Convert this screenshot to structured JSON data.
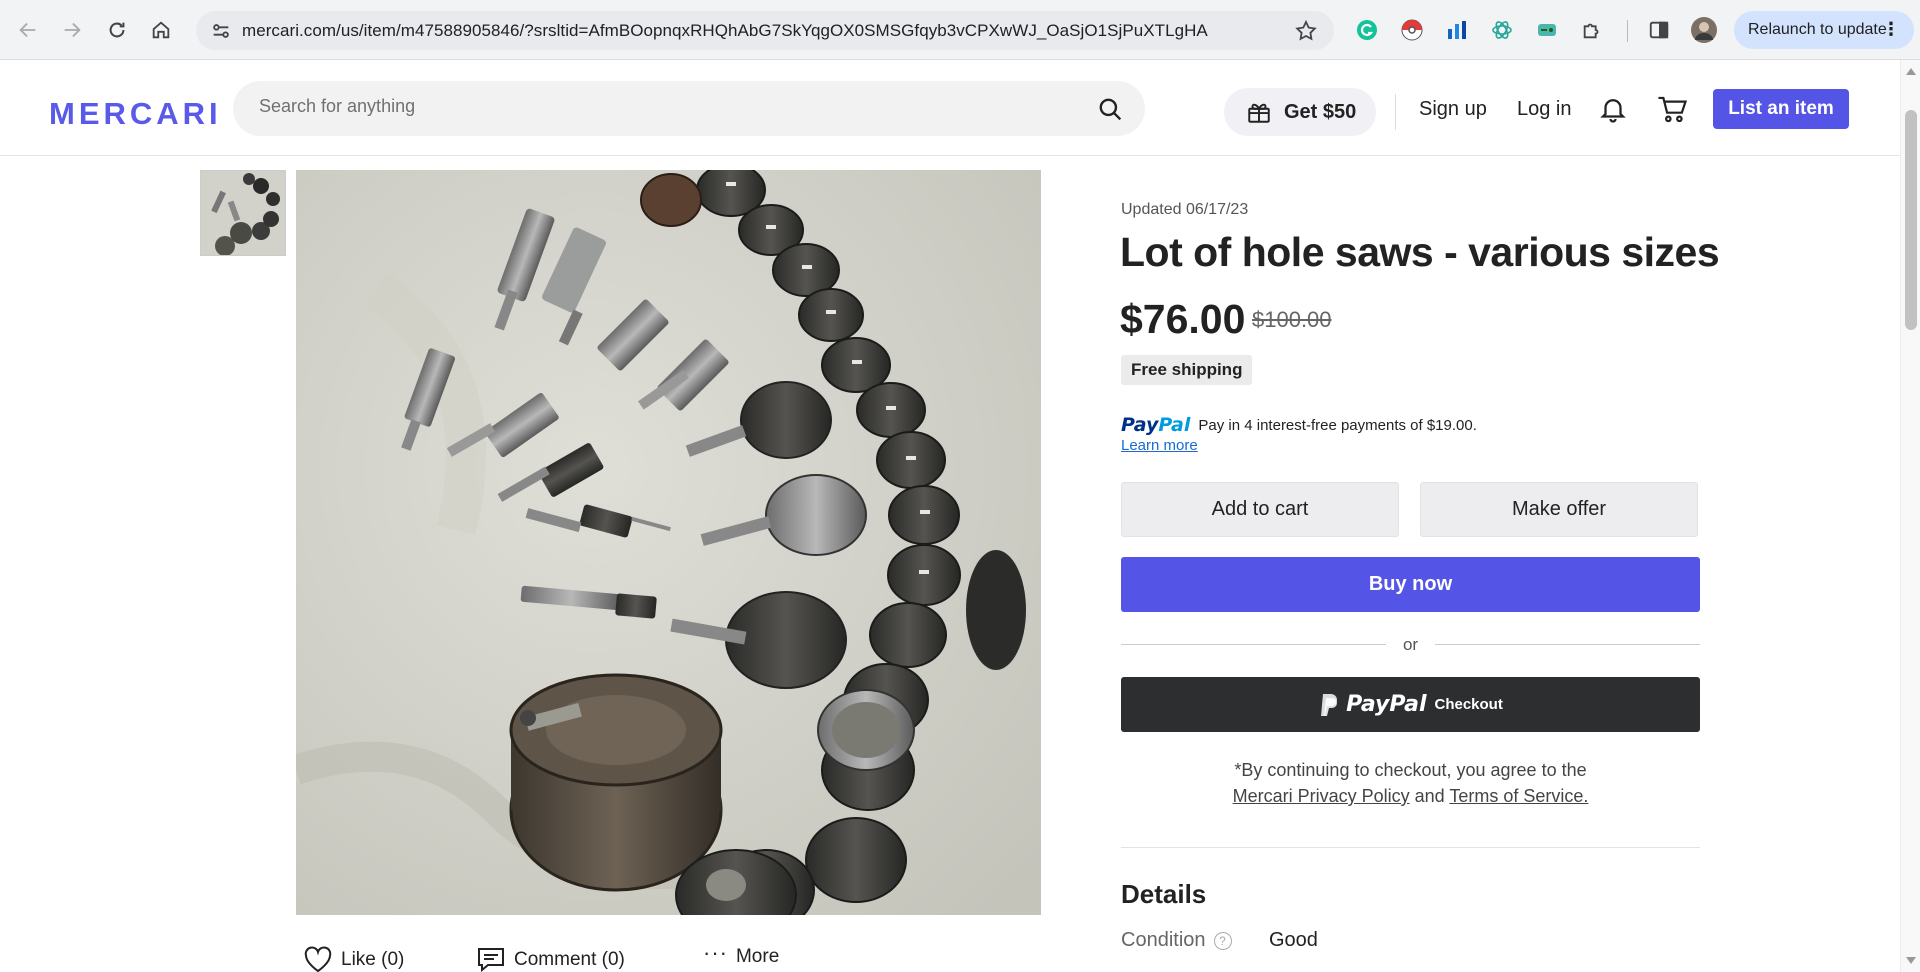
{
  "browser": {
    "url": "mercari.com/us/item/m47588905846/?srsltid=AfmBOopnqxRHQhAbG7SkYqgOX0SMSGfqyb3vCPXwWJ_OaSjO1SjPuXTLgHA",
    "relaunch_label": "Relaunch to update"
  },
  "header": {
    "logo": "MERCARI",
    "search_placeholder": "Search for anything",
    "promo_label": "Get $50",
    "signup_label": "Sign up",
    "login_label": "Log in",
    "list_item_label": "List an item"
  },
  "gallery": {
    "actions": {
      "like_label": "Like (0)",
      "comment_label": "Comment (0)",
      "more_label": "More"
    }
  },
  "product": {
    "updated": "Updated 06/17/23",
    "title": "Lot of hole saws - various sizes",
    "price": "$76.00",
    "original_price": "$100.00",
    "shipping_badge": "Free shipping",
    "paypal_brand_1": "Pay",
    "paypal_brand_2": "Pal",
    "paypal_installments": "Pay in 4 interest-free payments of $19.00.",
    "learn_more": "Learn more",
    "add_to_cart_label": "Add to cart",
    "make_offer_label": "Make offer",
    "buy_now_label": "Buy now",
    "or_label": "or",
    "paypal_checkout_brand": "PayPal",
    "paypal_checkout_label": "Checkout",
    "legal_prefix": "*By continuing to checkout, you agree to the",
    "privacy_link": "Mercari Privacy Policy",
    "legal_and": "and",
    "terms_link": "Terms of Service."
  },
  "details": {
    "heading": "Details",
    "condition_label": "Condition",
    "condition_value": "Good"
  },
  "colors": {
    "brand_purple": "#5454e6",
    "paypal_dark": "#2c2e2f",
    "paypal_blue": "#003087",
    "paypal_light_blue": "#009cde",
    "link_blue": "#1a6ad2"
  },
  "icons": [
    "back-arrow-icon",
    "forward-arrow-icon",
    "reload-icon",
    "home-icon",
    "site-info-icon",
    "bookmark-star-icon",
    "grammarly-icon",
    "pokeball-icon",
    "chart-extension-icon",
    "atom-extension-icon",
    "game-extension-icon",
    "puzzle-extensions-icon",
    "side-panel-icon",
    "profile-avatar",
    "menu-dots-icon",
    "search-icon",
    "gift-icon",
    "bell-icon",
    "cart-icon",
    "heart-icon",
    "comment-icon",
    "more-dots-icon",
    "help-question-icon"
  ]
}
